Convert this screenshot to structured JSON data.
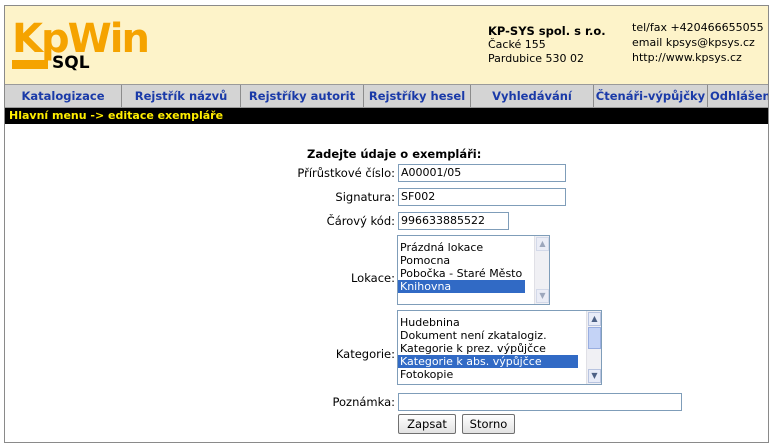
{
  "logo": {
    "top": "KpWin",
    "bottom": "SQL"
  },
  "company": {
    "name": "KP-SYS spol. s r.o.",
    "street": "Čacké 155",
    "city": "Pardubice 530 02"
  },
  "contact": {
    "phone": "tel/fax +420466655055",
    "email": "email kpsys@kpsys.cz",
    "web": "http://www.kpsys.cz"
  },
  "nav": {
    "items": [
      {
        "label": "Katalogizace"
      },
      {
        "label": "Rejstřík názvů"
      },
      {
        "label": "Rejstříky autorit"
      },
      {
        "label": "Rejstříky hesel"
      },
      {
        "label": "Vyhledávání"
      },
      {
        "label": "Čtenáři-výpůjčky"
      },
      {
        "label": "Odhlášení"
      }
    ]
  },
  "breadcrumb": "Hlavní menu -> editace exempláře",
  "form": {
    "title": "Zadejte údaje o exempláři:",
    "accession_label": "Přírůstkové číslo:",
    "accession_value": "A00001/05",
    "signature_label": "Signatura:",
    "signature_value": "SF002",
    "barcode_label": "Čárový kód:",
    "barcode_value": "996633885522",
    "location_label": "Lokace:",
    "location_options": [
      {
        "label": "Prázdná lokace",
        "selected": false
      },
      {
        "label": "Pomocna",
        "selected": false
      },
      {
        "label": "Pobočka - Staré Město",
        "selected": false
      },
      {
        "label": "Knihovna",
        "selected": true
      }
    ],
    "category_label": "Kategorie:",
    "category_options": [
      {
        "label": "Hudebnina",
        "selected": false
      },
      {
        "label": "Dokument není zkatalogiz.",
        "selected": false
      },
      {
        "label": "Kategorie k prez. výpůjčce",
        "selected": false
      },
      {
        "label": "Kategorie k abs. výpůjčce",
        "selected": true
      },
      {
        "label": "Fotokopie",
        "selected": false
      }
    ],
    "note_label": "Poznámka:",
    "note_value": "",
    "submit_label": "Zapsat",
    "cancel_label": "Storno"
  },
  "colors": {
    "header_bg": "#fdf3c9",
    "logo_orange": "#f5a300",
    "nav_text": "#1a3aa8",
    "breadcrumb_bg": "#000000",
    "breadcrumb_text": "#ffee00",
    "selection": "#316ac5"
  }
}
